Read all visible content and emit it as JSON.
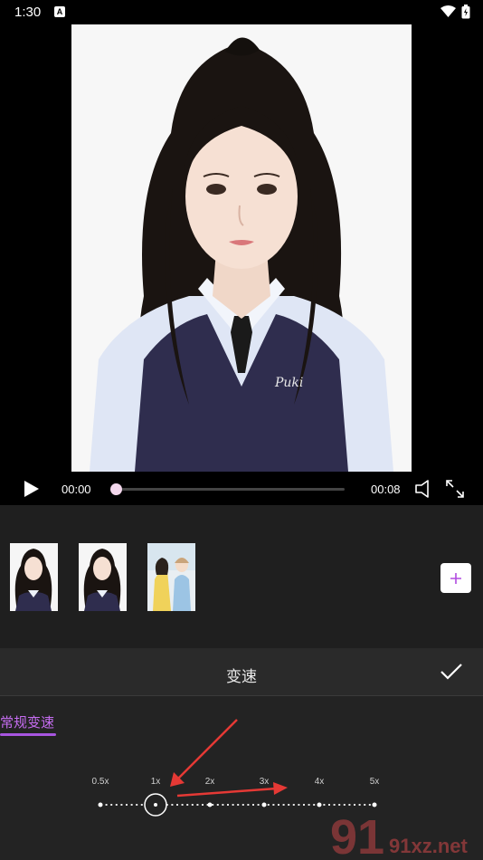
{
  "status": {
    "time": "1:30"
  },
  "player": {
    "current_time": "00:00",
    "total_time": "00:08",
    "progress": 0.0
  },
  "clips": {
    "count": 3
  },
  "panel": {
    "title": "变速",
    "tab_label": "常规变速",
    "speed_labels": [
      "0.5x",
      "1x",
      "2x",
      "3x",
      "4x",
      "5x"
    ],
    "selected_speed": "1x"
  },
  "colors": {
    "accent": "#a855e0",
    "tab_text": "#c56cf0",
    "annotation": "#e53935"
  },
  "watermark": {
    "text": "91xz.net"
  }
}
